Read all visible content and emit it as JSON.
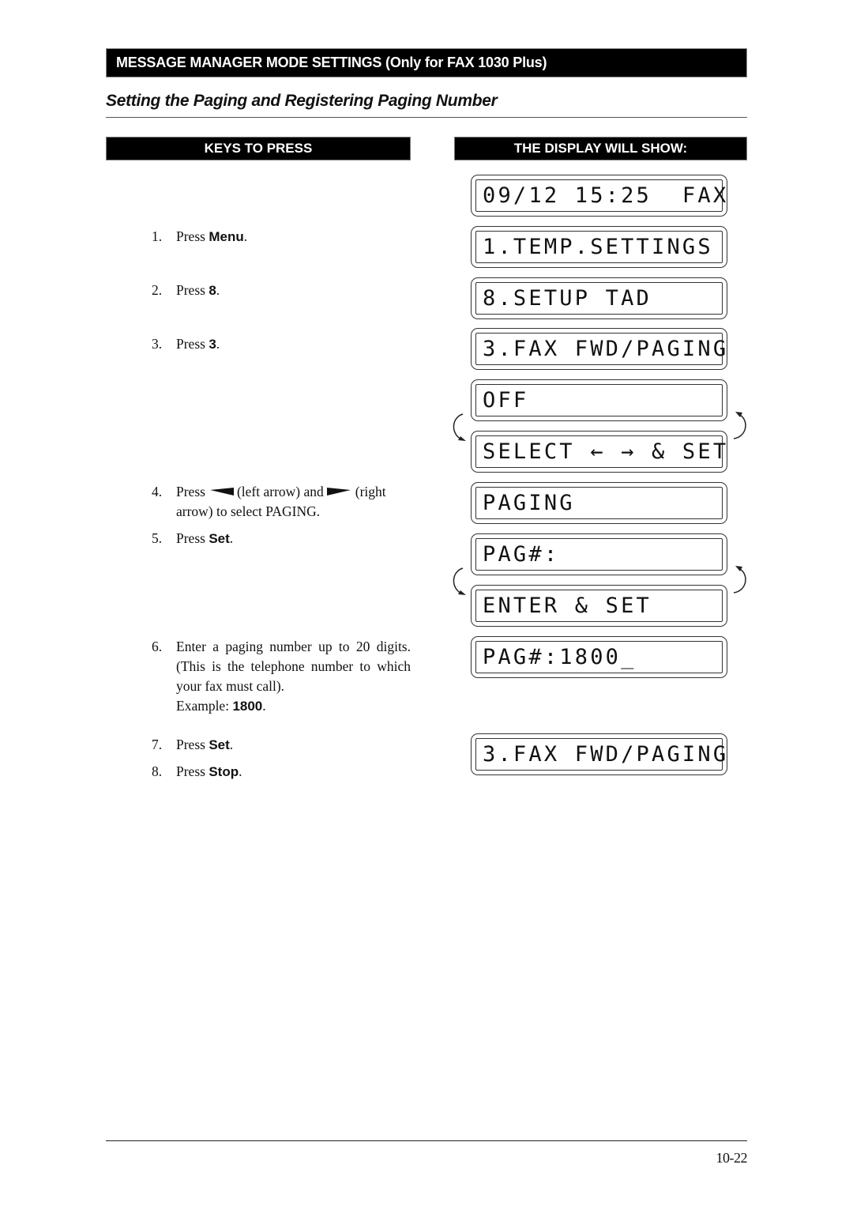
{
  "header": {
    "section": "MESSAGE MANAGER MODE SETTINGS (Only for FAX 1030 Plus)",
    "title": "Setting the Paging and Registering Paging Number"
  },
  "columns": {
    "keys": "KEYS TO PRESS",
    "display": "THE DISPLAY WILL SHOW:"
  },
  "steps": [
    {
      "num": "1.",
      "prefix": "Press ",
      "key": "Menu",
      "suffix": "."
    },
    {
      "num": "2.",
      "prefix": "Press ",
      "key": "8",
      "suffix": "."
    },
    {
      "num": "3.",
      "prefix": "Press ",
      "key": "3",
      "suffix": "."
    },
    {
      "num": "4.",
      "prefix": "Press",
      "left_arrow_icon": "left-arrow-key",
      "mid": "(left arrow) and",
      "right_arrow_icon": "right-arrow-key",
      "suffix": "(right arrow) to select PAGING."
    },
    {
      "num": "5.",
      "prefix": "Press ",
      "key": "Set",
      "suffix": "."
    },
    {
      "num": "6.",
      "text": "Enter a paging number up to 20 digits. (This is the telephone number to which your fax must call).",
      "example_prefix": "Example: ",
      "key": "1800",
      "suffix": "."
    },
    {
      "num": "7.",
      "prefix": "Press ",
      "key": "Set",
      "suffix": "."
    },
    {
      "num": "8.",
      "prefix": "Press ",
      "key": "Stop",
      "suffix": "."
    }
  ],
  "displays": [
    "09/12 15:25  FAX",
    "1.TEMP.SETTINGS",
    "8.SETUP TAD",
    "3.FAX FWD/PAGING",
    "OFF",
    "SELECT ← → & SET",
    "PAGING",
    "PAG#:",
    "ENTER & SET",
    "PAG#:1800_",
    "3.FAX FWD/PAGING"
  ],
  "footer": {
    "page_number": "10-22"
  }
}
